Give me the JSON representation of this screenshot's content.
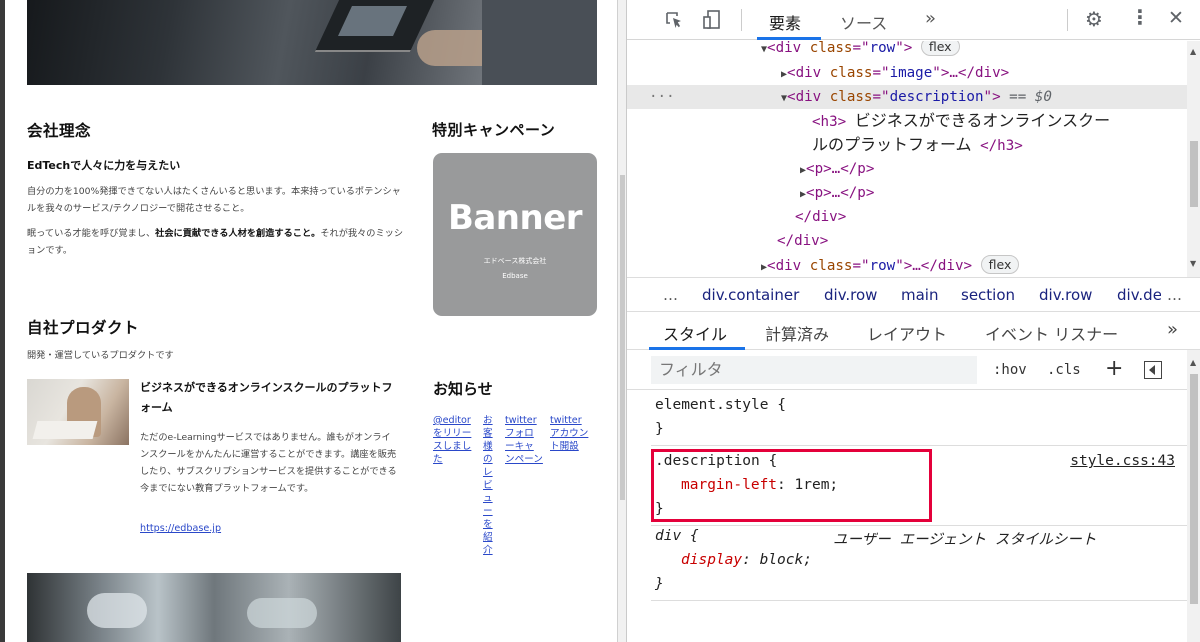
{
  "page": {
    "sections": {
      "philosophy": {
        "title": "会社理念",
        "subtitle": "EdTechで人々に力を与えたい",
        "para1": "自分の力を100%発揮できてない人はたくさんいると思います。本来持っているポテンシャルを我々のサービス/テクノロジーで開花させること。",
        "para2_pre": "眠っている才能を呼び覚まし、",
        "para2_bold": "社会に貢献できる人材を創造すること。",
        "para2_post": "それが我々のミッションです。"
      },
      "products": {
        "title": "自社プロダクト",
        "subtitle": "開発・運営しているプロダクトです",
        "item_title": "ビジネスができるオンラインスクールのプラットフォーム",
        "item_text": "ただのe-Learningサービスではありません。誰もがオンラインスクールをかんたんに運営することができます。講座を販売したり、サブスクリプションサービスを提供することができる今までにない教育プラットフォームです。",
        "item_link": "https://edbase.jp"
      }
    },
    "sidebar": {
      "campaign_title": "特別キャンペーン",
      "banner_big": "Banner",
      "banner_company": "エドベース株式会社",
      "banner_name": "Edbase",
      "news_title": "お知らせ",
      "news_links": [
        "@editorをリリースしました",
        "お客様のレビューを紹介",
        "twitterフォローキャンペーン",
        "twitterアカウント開設"
      ]
    }
  },
  "devtools": {
    "tabs": [
      "要素",
      "ソース"
    ],
    "more_tabs": "»",
    "tree": {
      "row_open": {
        "tag": "div",
        "attr": "class",
        "value": "row",
        "badge": "flex"
      },
      "image": {
        "tag": "div",
        "attr": "class",
        "value": "image"
      },
      "description": {
        "tag": "div",
        "attr": "class",
        "value": "description",
        "eq": "== $0"
      },
      "h3_text": "ビジネスができるオンラインスクールのプラットフォーム",
      "h3_line1": "ビジネスができるオンラインスクー",
      "h3_line2": "ルのプラットフォーム",
      "p": "p",
      "close_div": "</div>",
      "row_closed": {
        "tag": "div",
        "attr": "class",
        "value": "row",
        "badge": "flex"
      }
    },
    "breadcrumbs": [
      "div.container",
      "div.row",
      "main",
      "section",
      "div.row",
      "div.de"
    ],
    "style_tabs": [
      "スタイル",
      "計算済み",
      "レイアウト",
      "イベント リスナー"
    ],
    "filter_placeholder": "フィルタ",
    "hov": ":hov",
    "cls": ".cls",
    "rules": {
      "element_style": "element.style {",
      "description_selector": ".description {",
      "description_source": "style.css:43",
      "margin_prop": "margin-left",
      "margin_val": "1rem;",
      "div_selector": "div {",
      "ua_label": "ユーザー エージェント スタイルシート",
      "display_prop": "display",
      "display_val": "block;",
      "close": "}"
    },
    "colors": {
      "highlight": "#e4003a",
      "accent": "#1a73e8"
    }
  }
}
